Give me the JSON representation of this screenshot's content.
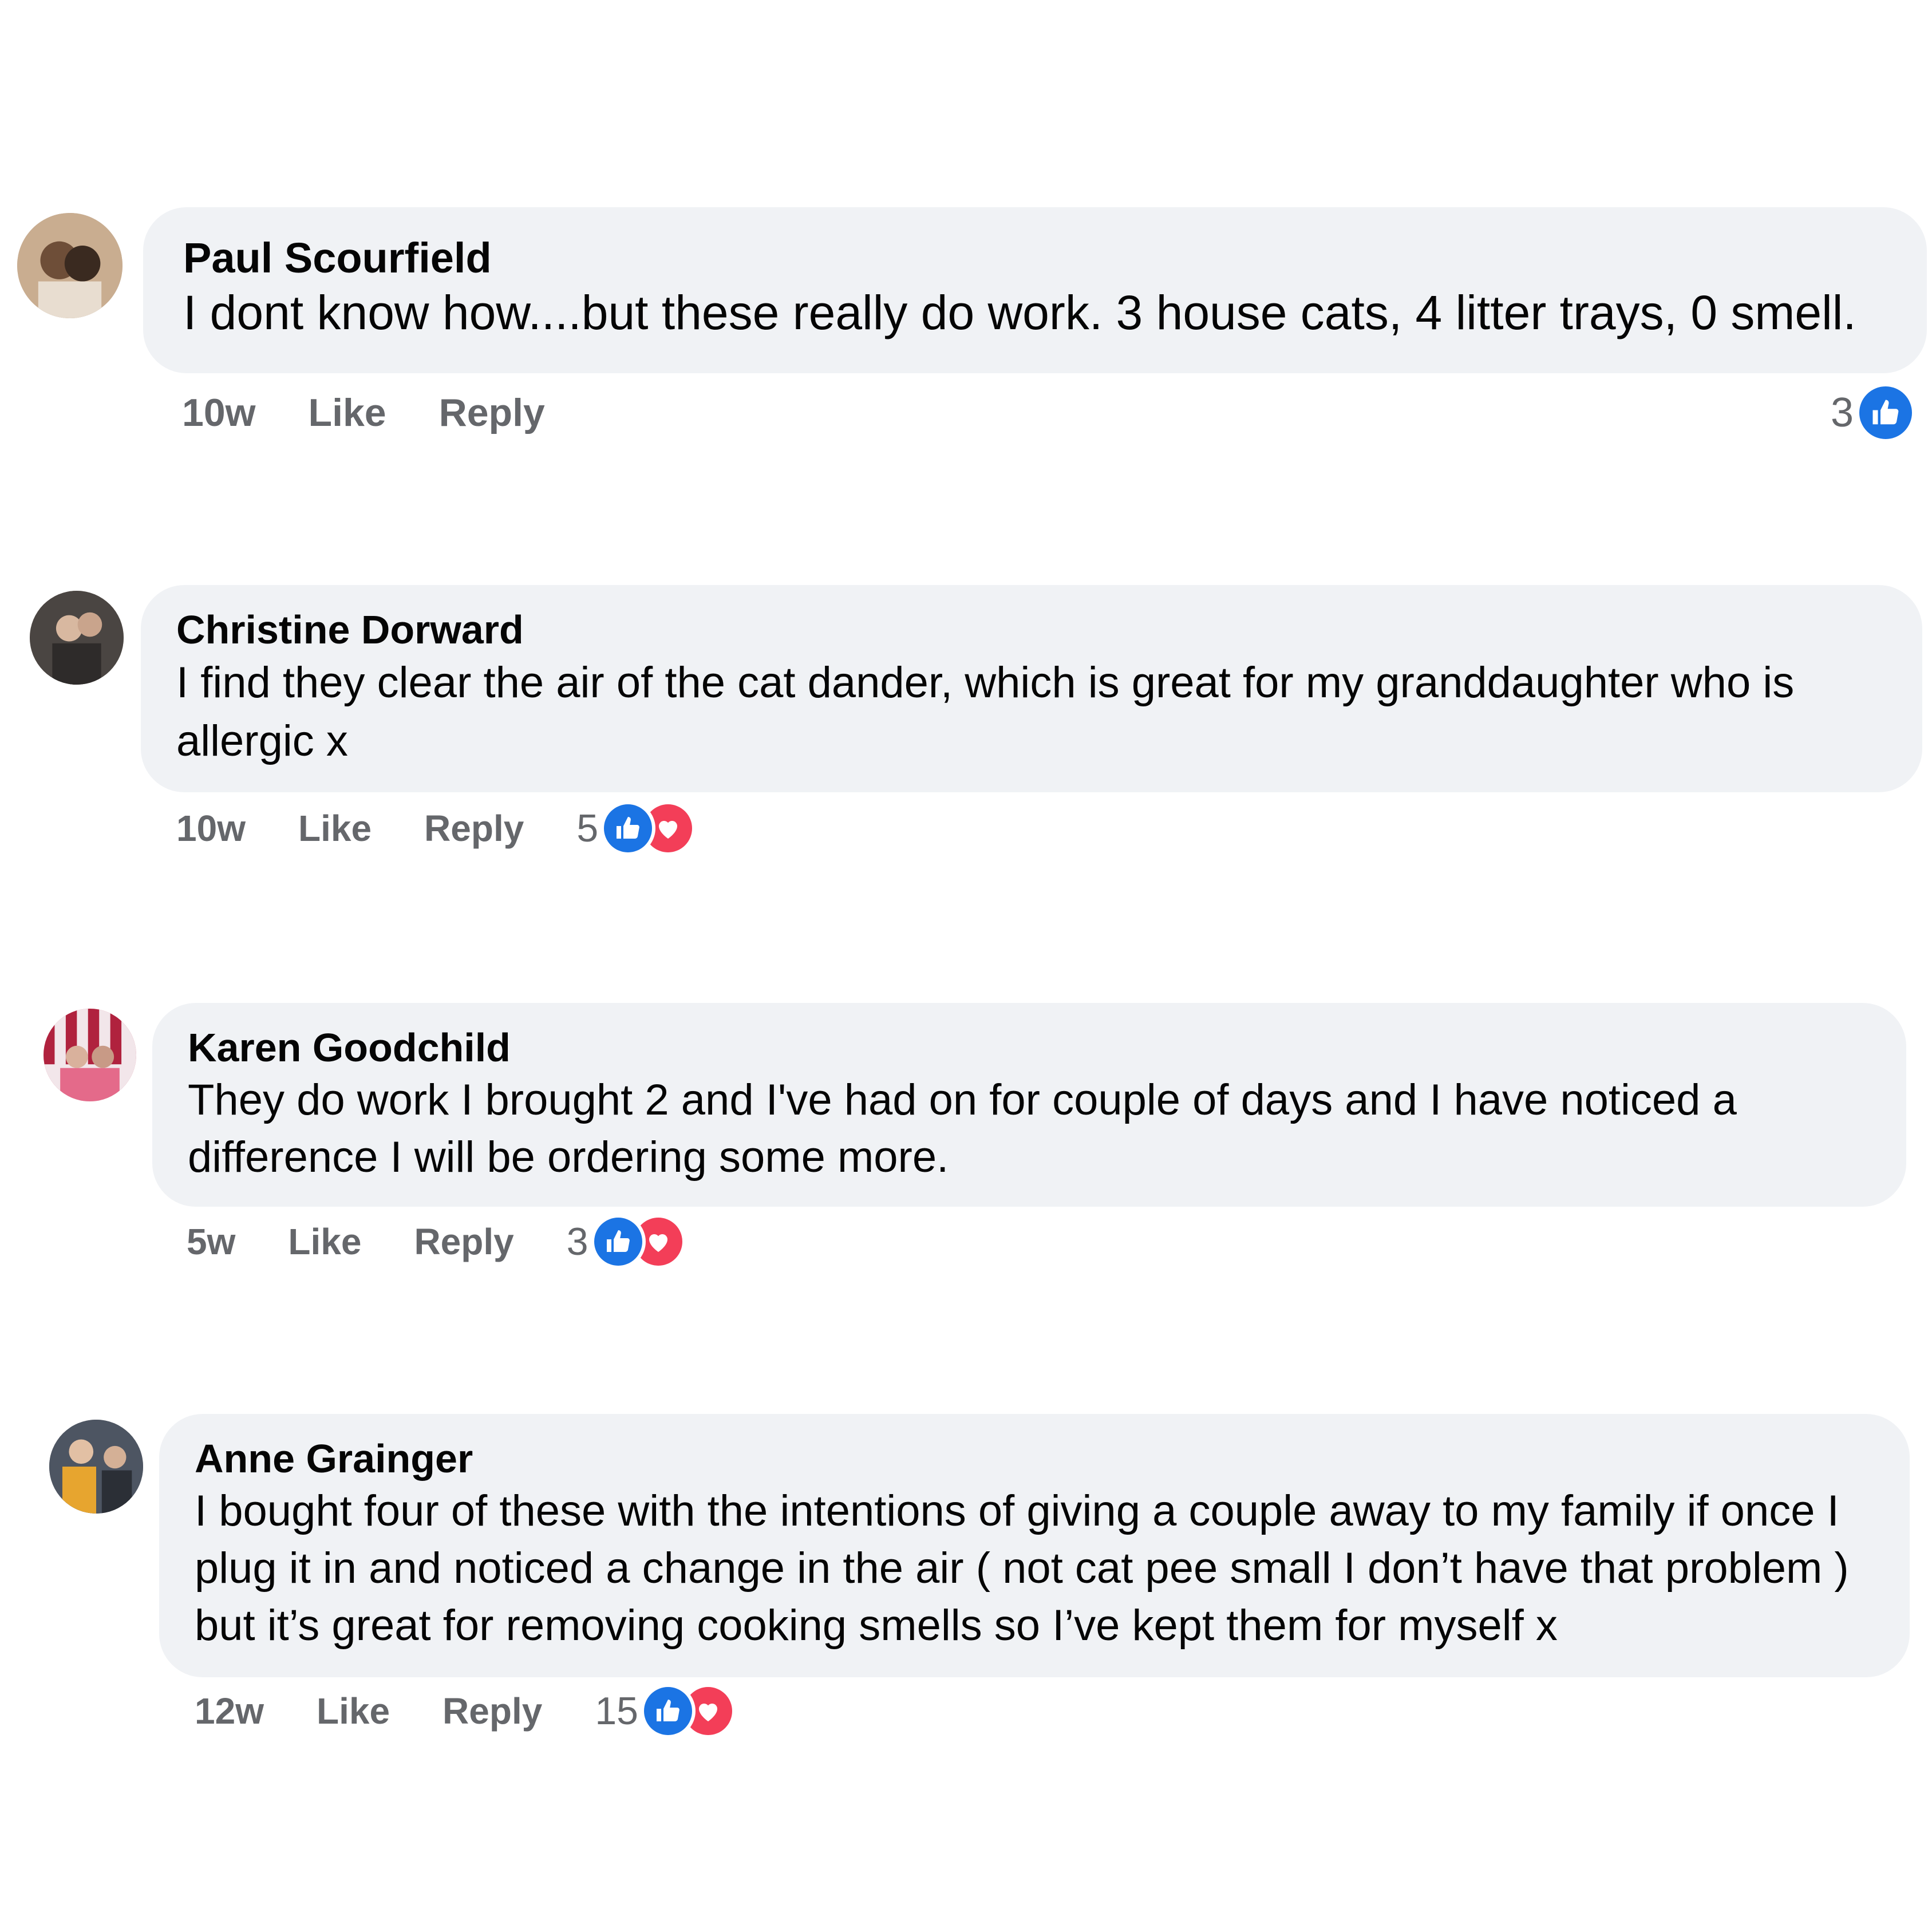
{
  "colors": {
    "bubble": "#f0f2f5",
    "meta_text": "#65676b",
    "like_blue": "#1b74e4",
    "love_red": "#f33e58"
  },
  "comments": [
    {
      "author": "Paul Scourfield",
      "lines": [
        "I dont know how....but these really do work. 3 house cats, 4 litter trays, 0 smell."
      ],
      "time": "10w",
      "like_label": "Like",
      "reply_label": "Reply",
      "reaction_count": "3",
      "reactions": [
        "like-icon"
      ]
    },
    {
      "author": "Christine Dorward",
      "lines": [
        "I find they clear the air of the cat dander, which is great for my granddaughter who is",
        "allergic x"
      ],
      "time": "10w",
      "like_label": "Like",
      "reply_label": "Reply",
      "reaction_count": "5",
      "reactions": [
        "like-icon",
        "love-icon"
      ]
    },
    {
      "author": "Karen Goodchild",
      "lines": [
        "They do work I brought 2 and I've had on for couple of days and I have noticed a",
        "difference I will be ordering some more."
      ],
      "time": "5w",
      "like_label": "Like",
      "reply_label": "Reply",
      "reaction_count": "3",
      "reactions": [
        "like-icon",
        "love-icon"
      ]
    },
    {
      "author": "Anne Grainger",
      "lines": [
        "I bought four of these with the intentions of giving a couple away to my family if once I",
        "plug it in and noticed a change in the air ( not cat pee small I don’t have that problem )",
        "but it’s great for removing cooking smells so I’ve kept them for myself x"
      ],
      "time": "12w",
      "like_label": "Like",
      "reply_label": "Reply",
      "reaction_count": "15",
      "reactions": [
        "like-icon",
        "love-icon"
      ]
    }
  ]
}
